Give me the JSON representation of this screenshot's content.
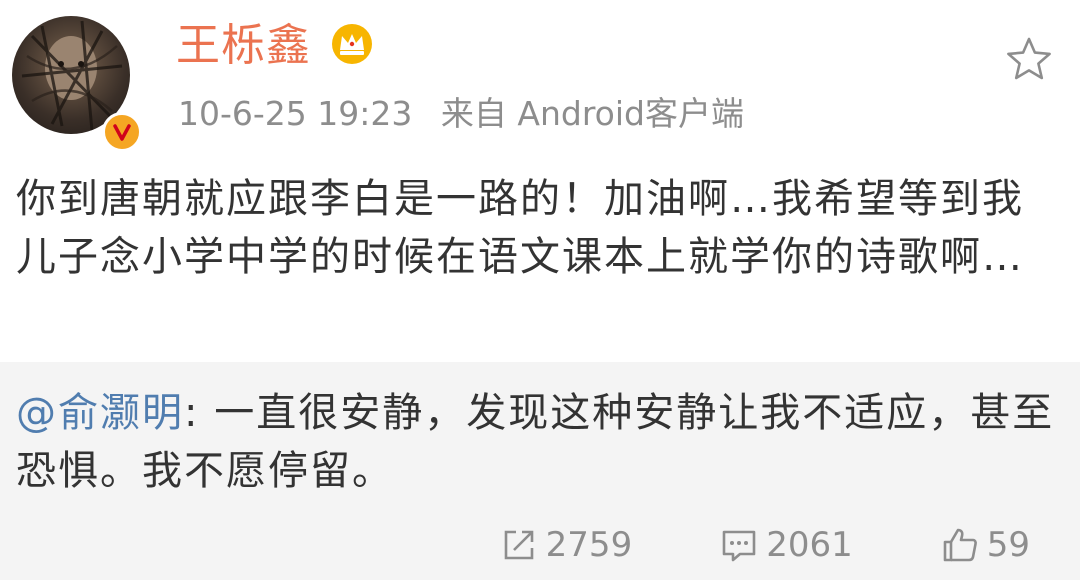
{
  "author": {
    "name": "王栎鑫",
    "avatar_icon": "avatar-image",
    "verified_icon": "verified-v-badge",
    "badge_icon": "crown-icon"
  },
  "meta": {
    "time": "10-6-25 19:23",
    "source": "来自 Android客户端"
  },
  "post": {
    "text": "你到唐朝就应跟李白是一路的！加油啊…我希望等到我儿子念小学中学的时候在语文课本上就学你的诗歌啊…"
  },
  "repost": {
    "mention": "@俞灏明",
    "text": ": 一直很安静，发现这种安静让我不适应，甚至恐惧。我不愿停留。",
    "actions": {
      "share_count": "2759",
      "comment_count": "2061",
      "like_count": "59"
    }
  },
  "colors": {
    "username": "#eb7350",
    "mention": "#507daf",
    "meta": "#8d8d8d",
    "body": "#333333",
    "repost_bg": "#f4f4f4"
  }
}
